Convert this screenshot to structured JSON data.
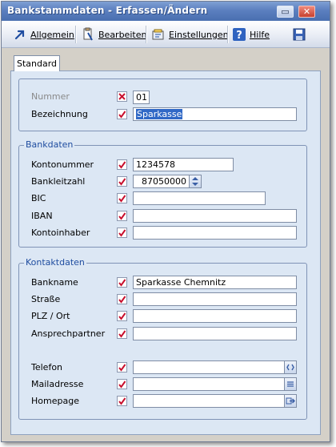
{
  "window": {
    "title": "Bankstammdaten - Erfassen/Ändern"
  },
  "toolbar": {
    "allgemein": "Allgemein",
    "bearbeiten": "Bearbeiten",
    "einstellungen": "Einstellungen",
    "hilfe": "Hilfe"
  },
  "tabs": {
    "standard": "Standard"
  },
  "top": {
    "nummer_label": "Nummer",
    "nummer_value": "01",
    "bezeichnung_label": "Bezeichnung",
    "bezeichnung_value": "Sparkasse"
  },
  "bankdaten": {
    "title": "Bankdaten",
    "kontonummer_label": "Kontonummer",
    "kontonummer_value": "1234578",
    "bankleitzahl_label": "Bankleitzahl",
    "bankleitzahl_value": "87050000",
    "bic_label": "BIC",
    "bic_value": "",
    "iban_label": "IBAN",
    "iban_value": "",
    "kontoinhaber_label": "Kontoinhaber",
    "kontoinhaber_value": ""
  },
  "kontaktdaten": {
    "title": "Kontaktdaten",
    "bankname_label": "Bankname",
    "bankname_value": "Sparkasse Chemnitz",
    "strasse_label": "Straße",
    "strasse_value": "",
    "plz_label": "PLZ / Ort",
    "plz_value": "",
    "ansprechpartner_label": "Ansprechpartner",
    "ansprechpartner_value": "",
    "telefon_label": "Telefon",
    "telefon_value": "",
    "mail_label": "Mailadresse",
    "mail_value": "",
    "homepage_label": "Homepage",
    "homepage_value": ""
  },
  "colors": {
    "title_bar": "#5b7fbf",
    "panel_bg": "#dce7f4",
    "group_title": "#1f4da0",
    "check_mark": "#c8102e",
    "selection": "#3169c6"
  },
  "icons": [
    "arrow-icon",
    "bearbeiten-icon",
    "einstellungen-icon",
    "help-icon",
    "save-icon",
    "check-icon",
    "x-icon",
    "spin-icon",
    "phone-icon",
    "mail-icon",
    "link-icon"
  ]
}
